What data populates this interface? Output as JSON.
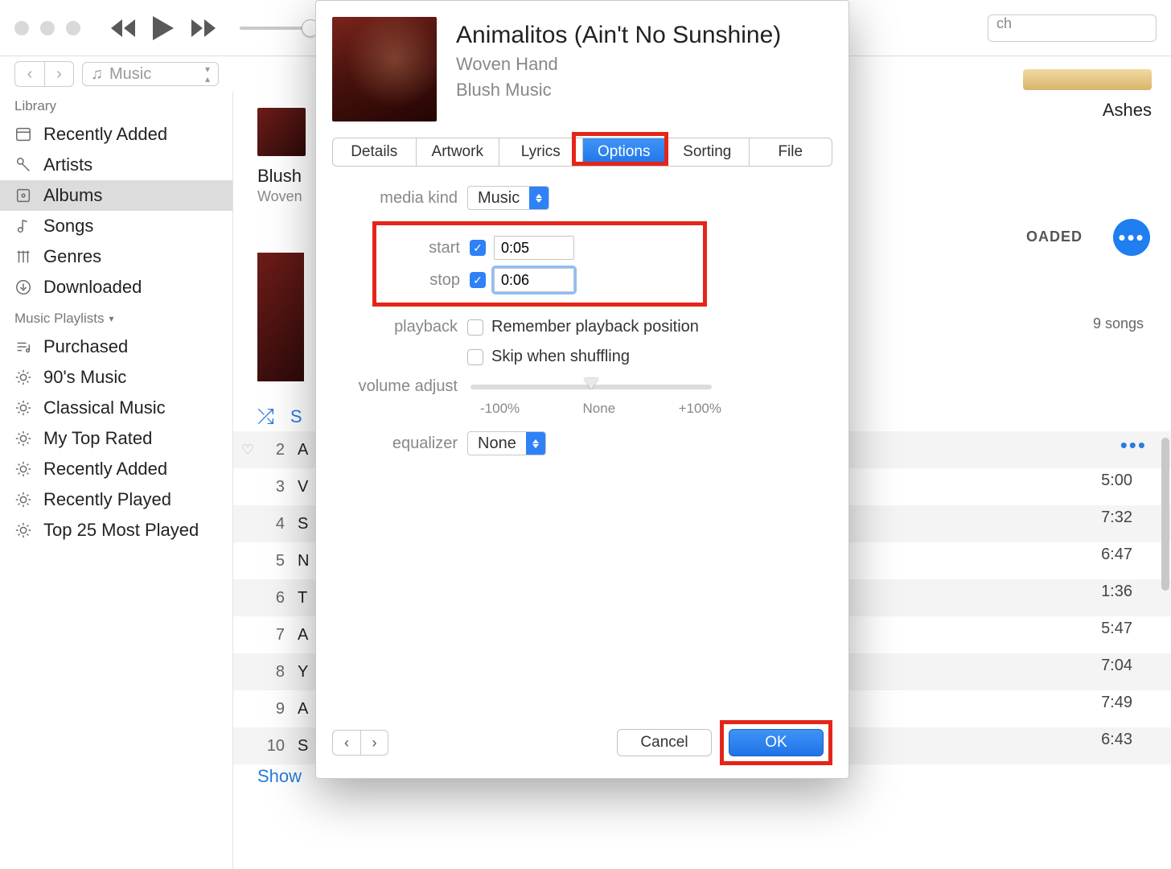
{
  "toolbar": {
    "search_placeholder": "ch",
    "library_popup": "Music"
  },
  "sidebar": {
    "library_header": "Library",
    "items": [
      {
        "label": "Recently Added"
      },
      {
        "label": "Artists"
      },
      {
        "label": "Albums",
        "selected": true
      },
      {
        "label": "Songs"
      },
      {
        "label": "Genres"
      },
      {
        "label": "Downloaded"
      }
    ],
    "playlists_header": "Music Playlists",
    "playlists": [
      {
        "label": "Purchased"
      },
      {
        "label": "90's Music"
      },
      {
        "label": "Classical Music"
      },
      {
        "label": "My Top Rated"
      },
      {
        "label": "Recently Added"
      },
      {
        "label": "Recently Played"
      },
      {
        "label": "Top 25 Most Played"
      }
    ]
  },
  "main": {
    "album_title": "Blush",
    "album_artist": "Woven",
    "shuffle": "S",
    "show_link": "Show",
    "ashes": "Ashes",
    "downloaded_badge": "OADED",
    "songs_count": "9 songs",
    "tracks": [
      {
        "n": "2",
        "t": "A",
        "heart": true,
        "more": true
      },
      {
        "n": "3",
        "t": "V",
        "dur": "5:00"
      },
      {
        "n": "4",
        "t": "S",
        "dur": "7:32"
      },
      {
        "n": "5",
        "t": "N",
        "dur": "6:47"
      },
      {
        "n": "6",
        "t": "T",
        "dur": "1:36"
      },
      {
        "n": "7",
        "t": "A",
        "dur": "5:47"
      },
      {
        "n": "8",
        "t": "Y",
        "dur": "7:04"
      },
      {
        "n": "9",
        "t": "A",
        "dur": "7:49"
      },
      {
        "n": "10",
        "t": "S",
        "dur": "6:43"
      }
    ]
  },
  "modal": {
    "title": "Animalitos (Ain't No Sunshine)",
    "artist": "Woven Hand",
    "album": "Blush Music",
    "tabs": [
      "Details",
      "Artwork",
      "Lyrics",
      "Options",
      "Sorting",
      "File"
    ],
    "active_tab": "Options",
    "labels": {
      "media_kind": "media kind",
      "start": "start",
      "stop": "stop",
      "playback": "playback",
      "volume": "volume adjust",
      "equalizer": "equalizer",
      "remember": "Remember playback position",
      "skip": "Skip when shuffling"
    },
    "values": {
      "media_kind": "Music",
      "start": "0:05",
      "stop": "0:06",
      "equalizer": "None",
      "vol_minus": "-100%",
      "vol_none": "None",
      "vol_plus": "+100%"
    },
    "buttons": {
      "cancel": "Cancel",
      "ok": "OK"
    }
  }
}
